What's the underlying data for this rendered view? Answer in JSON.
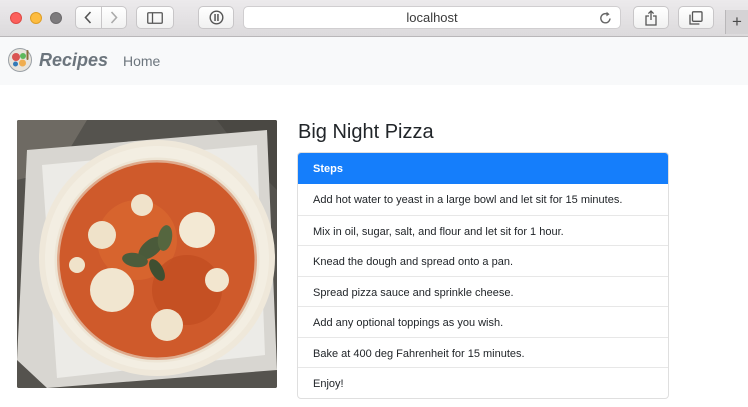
{
  "browser": {
    "url": "localhost",
    "icons": {
      "back": "chevron-left-icon",
      "forward": "chevron-right-icon",
      "sidebar": "sidebar-icon",
      "privacy": "shield-icon",
      "reload": "reload-icon",
      "share": "share-icon",
      "tabs": "tabs-overview-icon",
      "new_tab": "+"
    }
  },
  "navbar": {
    "brand": "Recipes",
    "home_link": "Home"
  },
  "recipe": {
    "title": "Big Night Pizza",
    "steps_header": "Steps",
    "steps": [
      "Add hot water to yeast in a large bowl and let sit for 15 minutes.",
      "Mix in oil, sugar, salt, and flour and let sit for 1 hour.",
      "Knead the dough and spread onto a pan.",
      "Spread pizza sauce and sprinkle cheese.",
      "Add any optional toppings as you wish.",
      "Bake at 400 deg Fahrenheit for 15 minutes.",
      "Enjoy!"
    ]
  },
  "colors": {
    "accent": "#157efb",
    "navbar_bg": "#f8f9fa",
    "muted_text": "#6c757d"
  }
}
